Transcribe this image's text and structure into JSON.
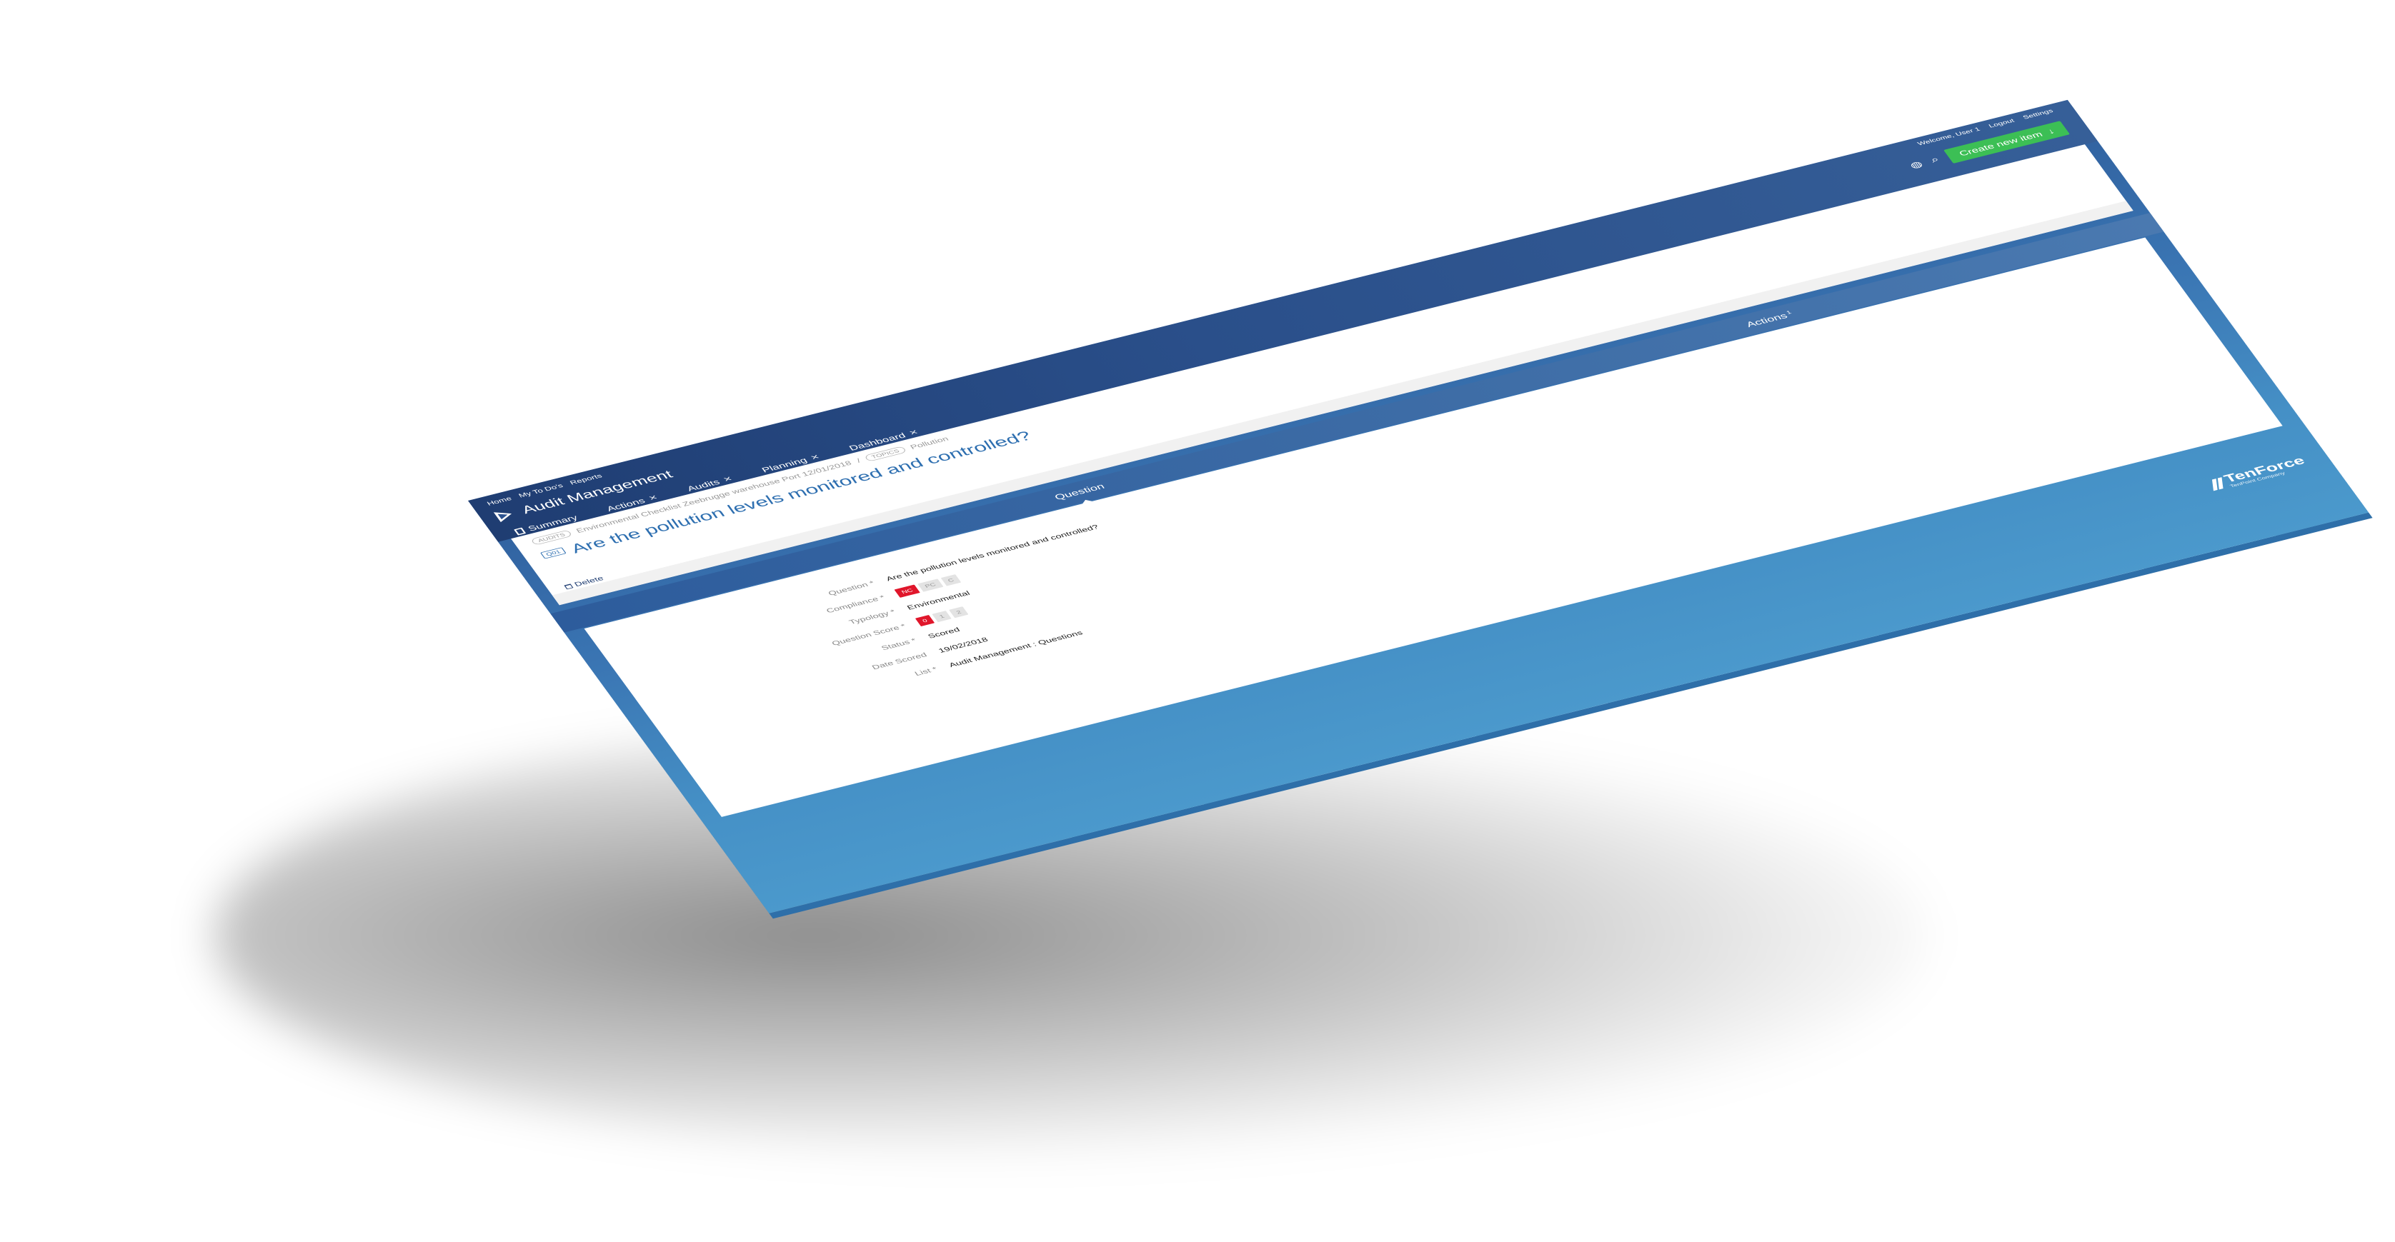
{
  "nav": {
    "links": [
      "Home",
      "My To Do's",
      "Reports"
    ],
    "welcome": "Welcome, User 1",
    "logout": "Logout",
    "settings": "Settings"
  },
  "app": {
    "title": "Audit Management"
  },
  "toolbar": {
    "create_label": "Create new item"
  },
  "tabs": [
    {
      "label": "Summary"
    },
    {
      "label": "Actions"
    },
    {
      "label": "Audits"
    },
    {
      "label": "Planning"
    },
    {
      "label": "Dashboard"
    }
  ],
  "breadcrumb": {
    "audit_pill": "AUDITS",
    "audit_text": "Environmental Checklist Zeebrugge warehouse Port 12/01/2018",
    "separator": "/",
    "topic_pill": "TOPICS",
    "topic_text": "Pollution"
  },
  "question_badge": "Q01",
  "page_title": "Are the pollution levels monitored and controlled?",
  "delete_label": "Delete",
  "subtabs": {
    "question": "Question",
    "actions": "Actions",
    "actions_count": "1"
  },
  "form": {
    "question_label": "Question",
    "question_value": "Are the pollution levels monitored and controlled?",
    "compliance_label": "Compliance",
    "compliance_options": [
      "NC",
      "PC",
      "C"
    ],
    "compliance_selected": "NC",
    "typology_label": "Typology",
    "typology_value": "Environmental",
    "score_label": "Question Score",
    "score_options": [
      "0",
      "1",
      "2"
    ],
    "score_selected": "0",
    "status_label": "Status",
    "status_value": "Scored",
    "date_label": "Date Scored",
    "date_value": "19/02/2018",
    "list_label": "List",
    "list_value": "Audit Management : Questions"
  },
  "logo": {
    "name": "TenForce",
    "tagline": "TenPoint Company"
  },
  "colors": {
    "header": "#1f3d72",
    "accent_blue": "#2e6fb0",
    "create_button": "#3cbf55",
    "noncompliant_red": "#e0162b"
  },
  "icons": [
    "play-icon",
    "globe-icon",
    "search-icon",
    "arrow-down-icon",
    "close-icon",
    "summary-doc-icon",
    "trash-icon"
  ]
}
